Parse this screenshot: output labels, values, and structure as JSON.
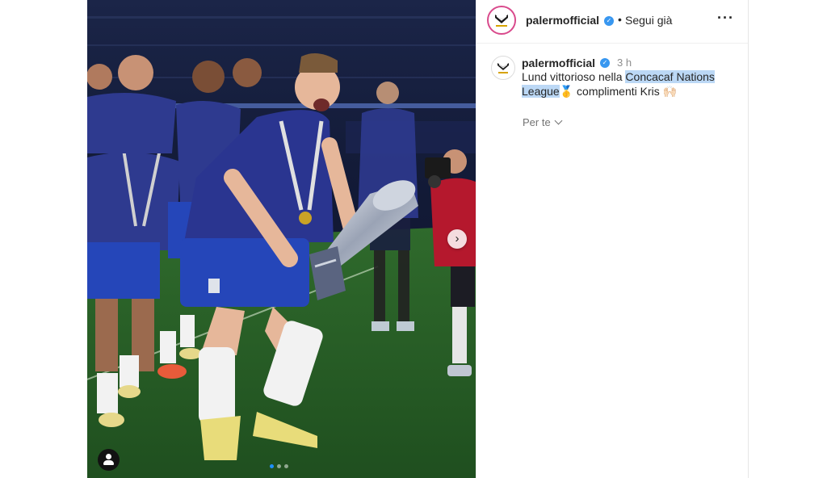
{
  "post": {
    "account": {
      "username": "palermofficial",
      "verified": true,
      "follow_status": "Segui già"
    },
    "caption": {
      "username": "palermofficial",
      "time": "3 h",
      "text_before": "Lund vittorioso nella ",
      "highlighted": "Concacaf Nations League",
      "text_after": "🥇 complimenti Kris 🙌🏻"
    },
    "translate_label": "Per te",
    "carousel": {
      "total": 3,
      "active_index": 0
    },
    "icons": {
      "verified": "verified-badge-icon",
      "more": "more-options-icon",
      "next": "chevron-right-icon",
      "tag": "user-tag-icon"
    },
    "colors": {
      "verified": "#3897f0",
      "highlight": "#bcd8f5",
      "active_dot": "#1e90ff"
    }
  }
}
